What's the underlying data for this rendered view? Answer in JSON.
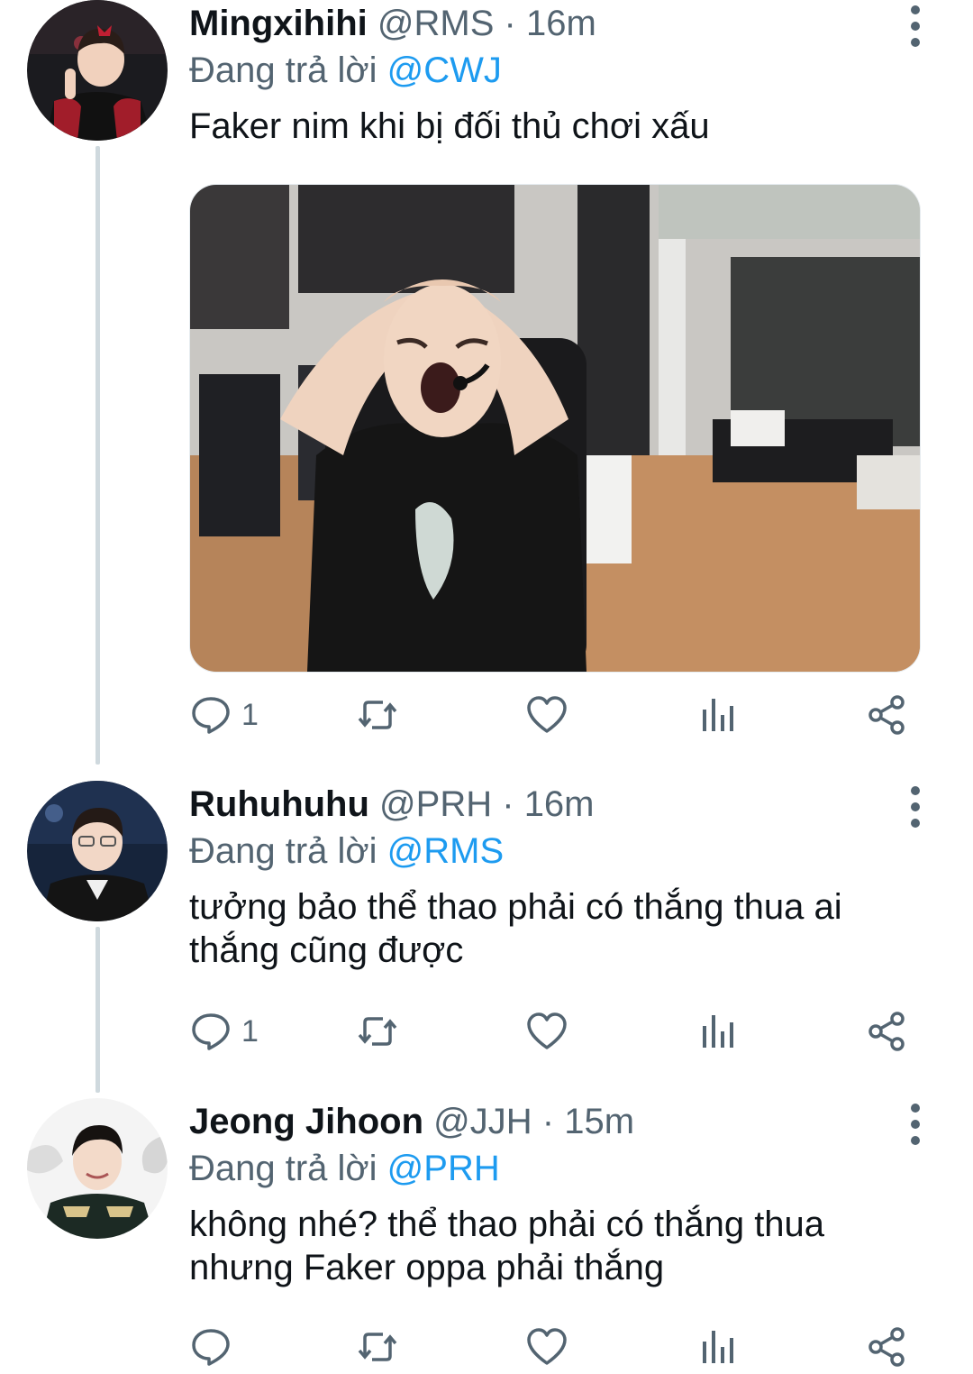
{
  "tweets": [
    {
      "name": "Mingxihihi",
      "handle": "@RMS",
      "separator": "·",
      "time": "16m",
      "reply_prefix": "Đang trả lời",
      "reply_to": "@CWJ",
      "text": "Faker nim khi bị đối thủ chơi xấu",
      "has_media": true,
      "reply_count": "1"
    },
    {
      "name": "Ruhuhuhu",
      "handle": "@PRH",
      "separator": "·",
      "time": "16m",
      "reply_prefix": "Đang trả lời",
      "reply_to": "@RMS",
      "text": "tưởng bảo thể thao phải có thắng thua ai thắng cũng được",
      "has_media": false,
      "reply_count": "1"
    },
    {
      "name": "Jeong Jihoon",
      "handle": "@JJH",
      "separator": "·",
      "time": "15m",
      "reply_prefix": "Đang trả lời",
      "reply_to": "@PRH",
      "text": "không nhé? thể thao phải có thắng thua nhưng Faker oppa phải thắng",
      "has_media": false,
      "reply_count": ""
    }
  ],
  "icons": {
    "reply": "reply-icon",
    "retweet": "retweet-icon",
    "like": "heart-icon",
    "views": "analytics-icon",
    "share": "share-icon",
    "more": "more-vertical-icon"
  },
  "colors": {
    "accent": "#1d9bf0",
    "secondary_text": "#536471",
    "thread_line": "#cfd9de",
    "primary_text": "#0f1419"
  }
}
